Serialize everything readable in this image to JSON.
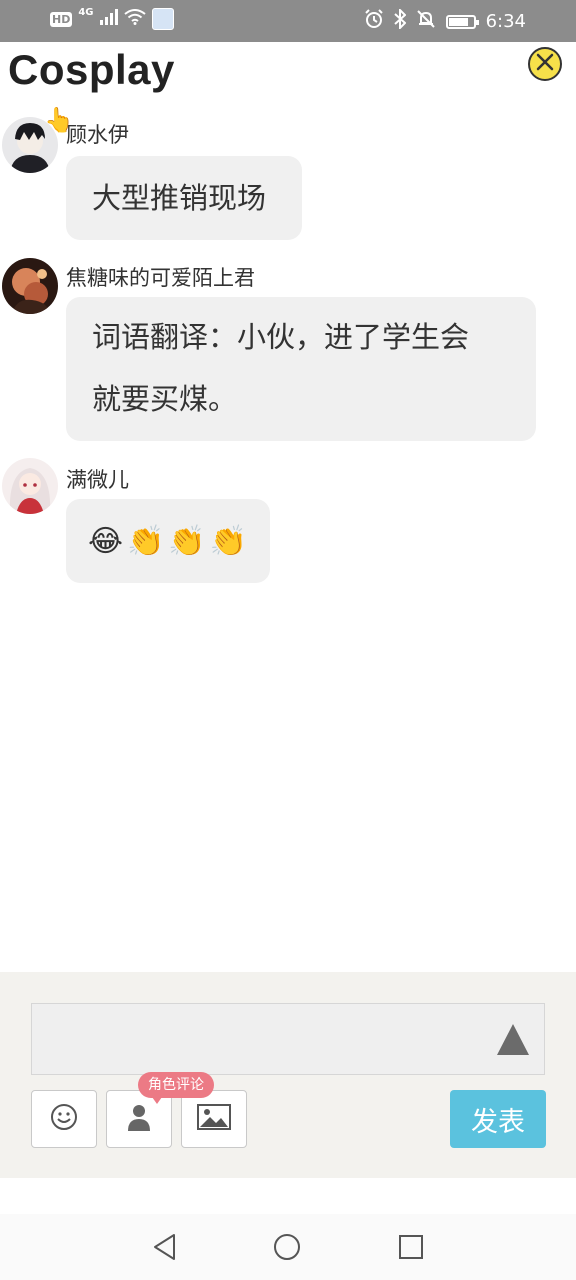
{
  "status_bar": {
    "network_badge": "HD",
    "network_type": "4G",
    "time": "6:34",
    "battery_level": 0.8
  },
  "header": {
    "title": "Cosplay"
  },
  "messages": [
    {
      "username": "顾水伊",
      "text": "大型推销现场"
    },
    {
      "username": "焦糖味的可爱陌上君",
      "lines": [
        "词语翻译：小伙，进了学生会",
        "就要买煤。"
      ]
    },
    {
      "username": "满微儿",
      "emojis": [
        "😂",
        "👏",
        "👏",
        "👏"
      ]
    }
  ],
  "composer": {
    "input_value": "",
    "role_comment_tag": "角色评论",
    "send_label": "发表"
  },
  "icons": {
    "close": "close-circle-icon",
    "emoji": "smiley-icon",
    "role": "person-icon",
    "image": "image-icon",
    "collapse": "triangle-up-icon",
    "nav_back": "triangle-back-icon",
    "nav_home": "circle-home-icon",
    "nav_recent": "square-recent-icon"
  },
  "colors": {
    "status_bar": "#8c8c8c",
    "close_button": "#f6e04a",
    "bubble": "#f0f0f0",
    "composer_bg": "#f3f2ee",
    "send_button": "#5bc2de",
    "role_tag": "#ec7a85"
  }
}
